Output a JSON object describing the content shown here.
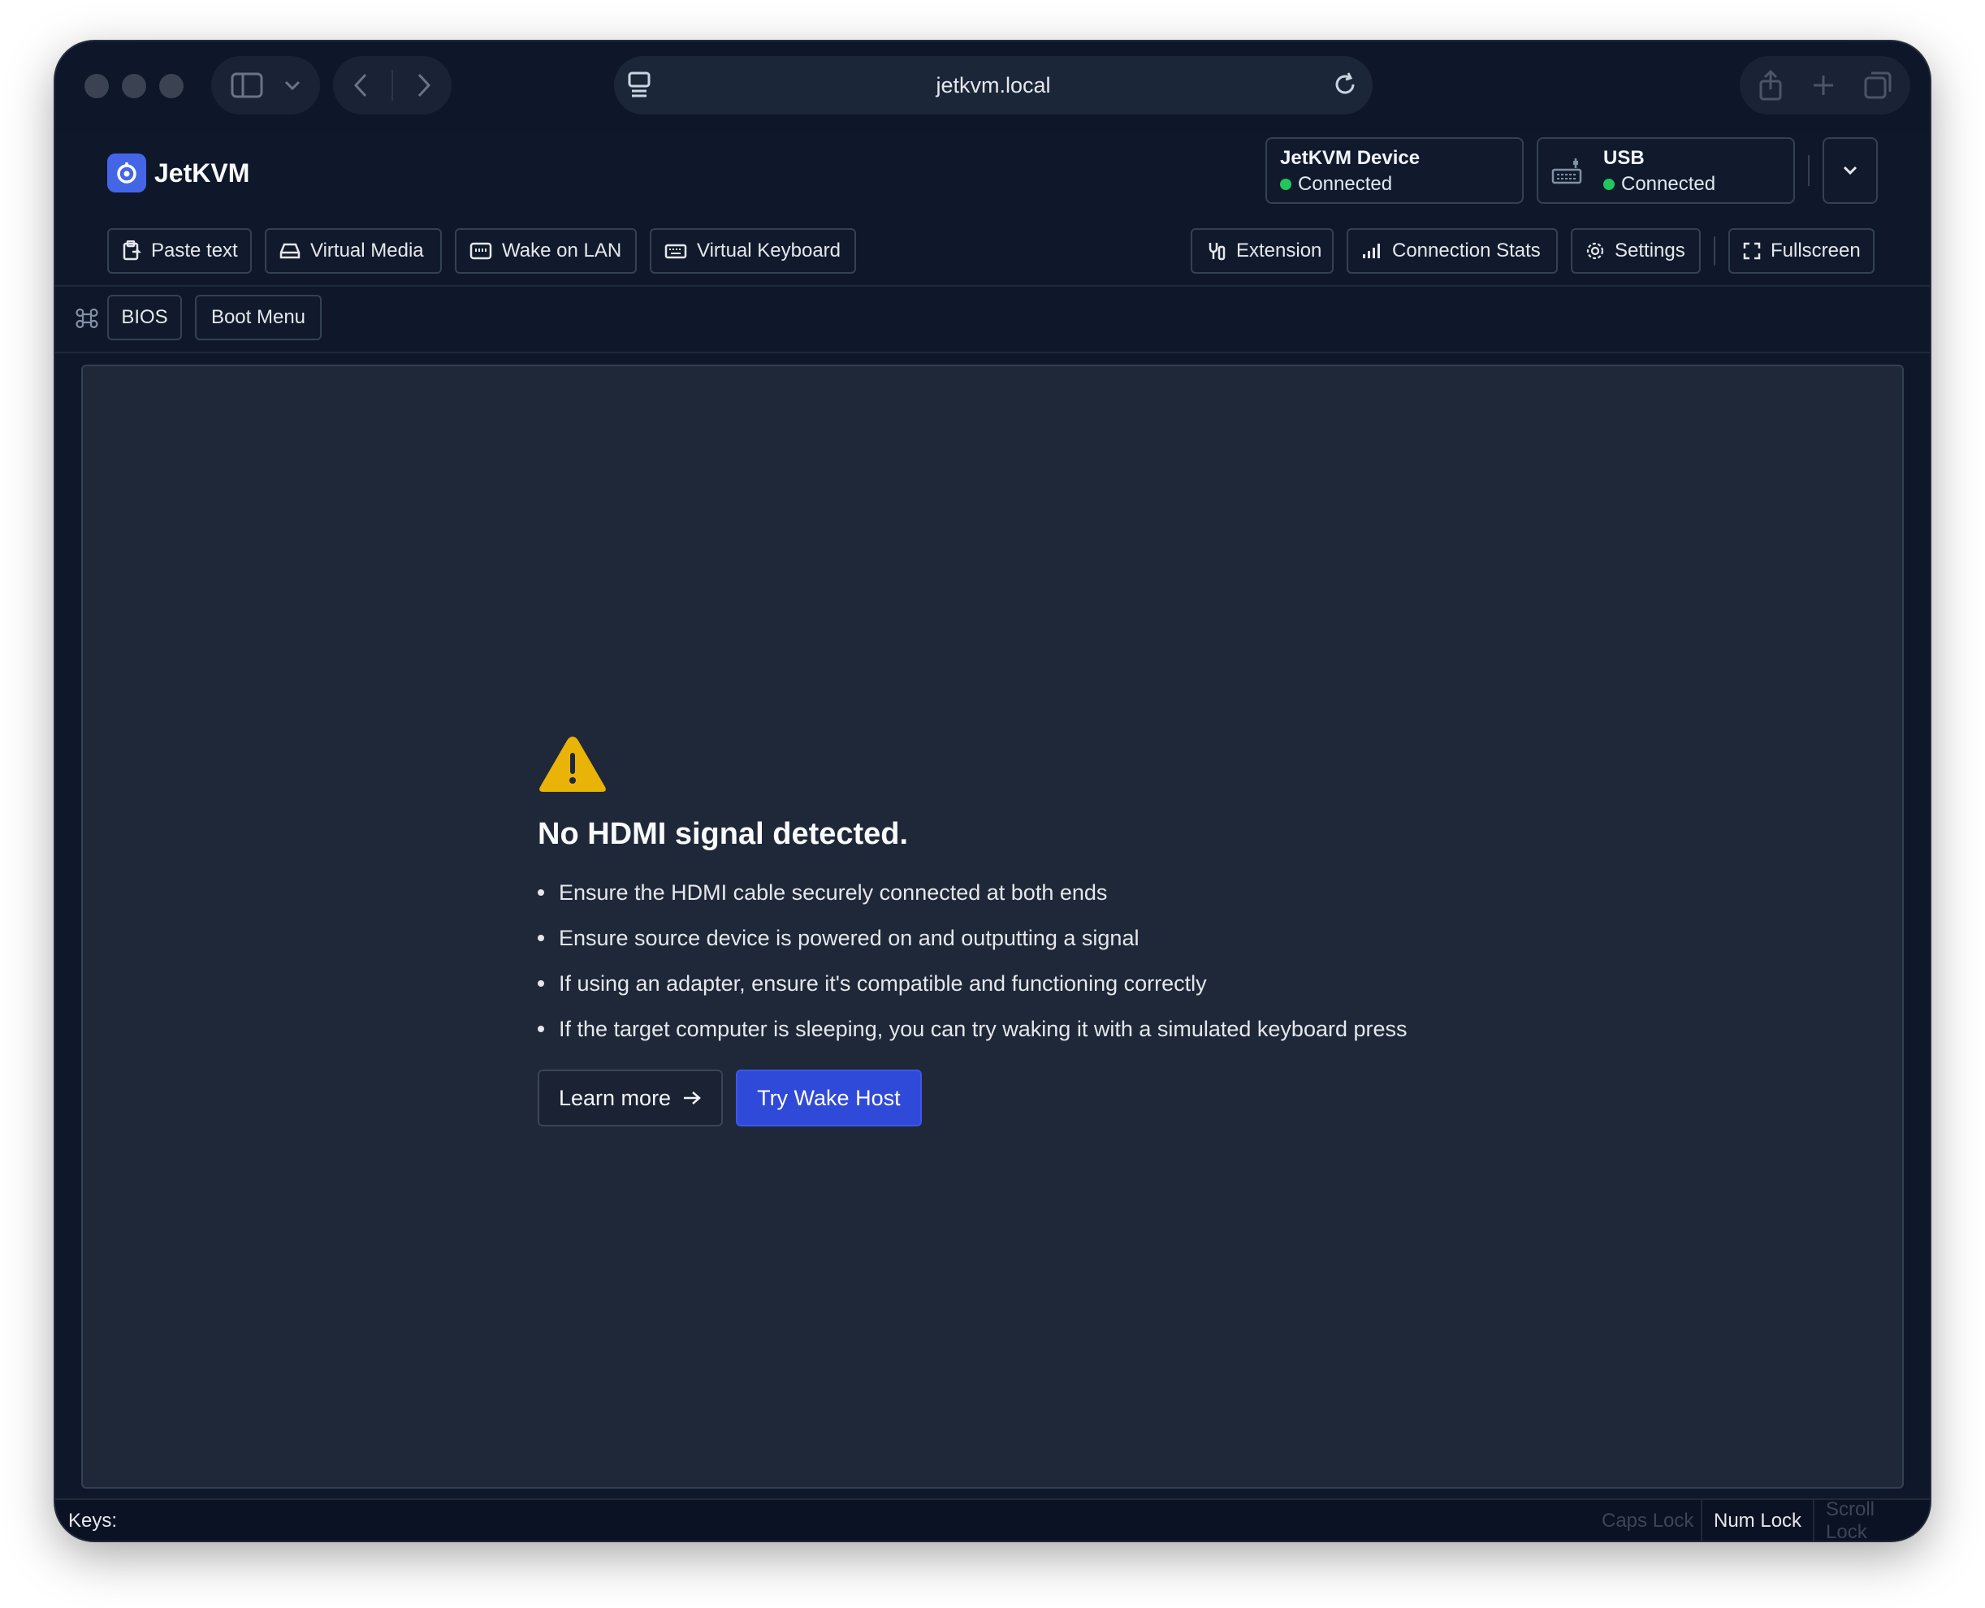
{
  "browser": {
    "url": "jetkvm.local",
    "icons": [
      "sidebar-icon",
      "chevron-down-icon",
      "back-icon",
      "forward-icon",
      "page-icon",
      "reload-icon",
      "share-icon",
      "plus-icon",
      "tabs-icon"
    ]
  },
  "app": {
    "name": "JetKVM",
    "brand_color": "#4466e6"
  },
  "status": {
    "device": {
      "title": "JetKVM Device",
      "state": "Connected"
    },
    "usb": {
      "title": "USB",
      "state": "Connected"
    },
    "ok_color": "#22c55e"
  },
  "toolbar": {
    "paste_text": "Paste text",
    "virtual_media": "Virtual Media",
    "wake_on_lan": "Wake on LAN",
    "virtual_keyboard": "Virtual Keyboard",
    "extension": "Extension",
    "connection_stats": "Connection Stats",
    "settings": "Settings",
    "fullscreen": "Fullscreen"
  },
  "macros": {
    "bios": "BIOS",
    "boot_menu": "Boot Menu"
  },
  "message": {
    "title": "No HDMI signal detected.",
    "tips": [
      "Ensure the HDMI cable securely connected at both ends",
      "Ensure source device is powered on and outputting a signal",
      "If using an adapter, ensure it's compatible and functioning correctly",
      "If the target computer is sleeping, you can try waking it with a simulated keyboard press"
    ],
    "learn_more": "Learn more",
    "try_wake": "Try Wake Host",
    "warning_color": "#eab308"
  },
  "footer": {
    "keys_label": "Keys:",
    "caps_lock": "Caps Lock",
    "num_lock": "Num Lock",
    "scroll_lock": "Scroll Lock"
  }
}
